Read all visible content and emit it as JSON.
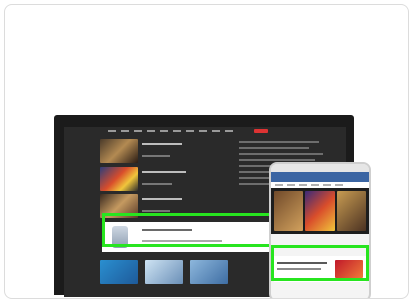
{
  "nav": {
    "items": [
      "",
      "",
      "",
      "",
      "",
      "",
      "",
      "",
      "",
      "",
      ""
    ],
    "brand": ""
  },
  "colors": {
    "highlight": "#27e51f",
    "monitor_frame": "#1b1b1b",
    "phone_header": "#3b65a3"
  },
  "icons": {
    "device_mockup": "desktop-and-phone-icon"
  }
}
